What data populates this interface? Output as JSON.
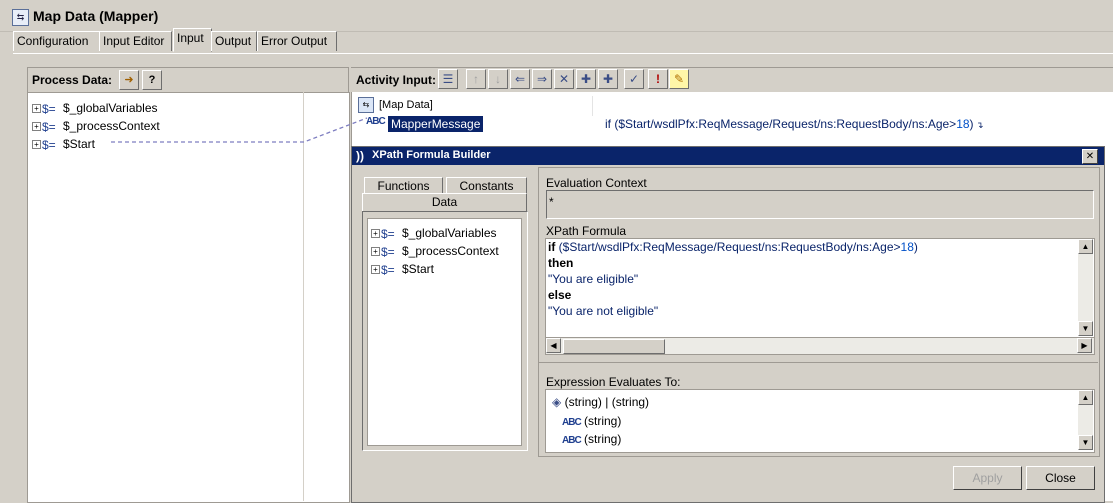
{
  "window": {
    "title": "Map Data (Mapper)"
  },
  "tabs": [
    "Configuration",
    "Input Editor",
    "Input",
    "Output",
    "Error Output"
  ],
  "process_data": {
    "label": "Process Data:",
    "items": [
      "$_globalVariables",
      "$_processContext",
      "$Start"
    ]
  },
  "activity_input": {
    "label": "Activity Input:",
    "root": "[Map Data]",
    "field": "MapperMessage",
    "expression_prefix": "if ($Start/wsdlPfx:ReqMessage/Request/ns:RequestBody/ns:Age>",
    "expression_num": "18",
    "expression_suffix": ")"
  },
  "dialog": {
    "title": "XPath Formula Builder",
    "tabs": {
      "functions": "Functions",
      "constants": "Constants",
      "data": "Data"
    },
    "data_items": [
      "$_globalVariables",
      "$_processContext",
      "$Start"
    ],
    "eval_context_label": "Evaluation Context",
    "eval_context_value": "*",
    "formula_label": "XPath Formula",
    "formula": {
      "line1_kw": "if",
      "line1_rest": " ($Start/wsdlPfx:ReqMessage/Request/ns:RequestBody/ns:Age>",
      "line1_num": "18",
      "line1_end": ")",
      "line2": "then",
      "line3": "\"You are eligible\"",
      "line4": "else",
      "line5": "\"You are not eligible\""
    },
    "result_label": "Expression Evaluates To:",
    "result": [
      "(string) | (string)",
      "(string)",
      "(string)"
    ],
    "apply_label": "Apply",
    "close_label": "Close"
  },
  "icons": {
    "tree_type": "$=",
    "string_type": "ABC"
  }
}
